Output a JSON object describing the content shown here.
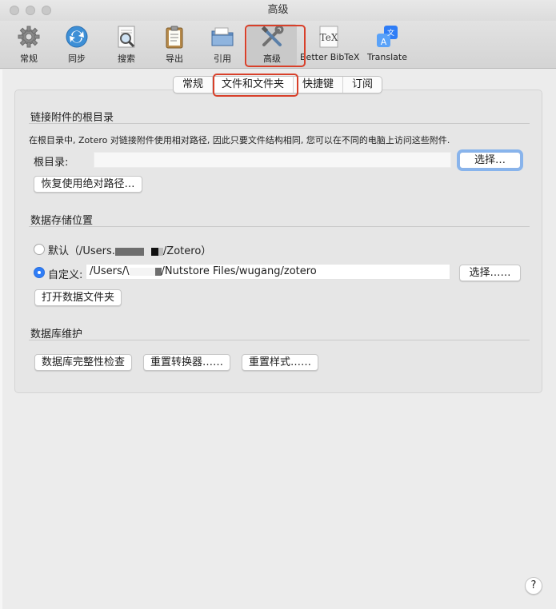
{
  "window": {
    "title": "高级"
  },
  "toolbar": {
    "items": [
      {
        "label": "常规",
        "icon": "gear-icon"
      },
      {
        "label": "同步",
        "icon": "sync-icon"
      },
      {
        "label": "搜索",
        "icon": "search-icon"
      },
      {
        "label": "导出",
        "icon": "clipboard-icon"
      },
      {
        "label": "引用",
        "icon": "folder-icon"
      },
      {
        "label": "高级",
        "icon": "tools-icon",
        "selected": true
      },
      {
        "label": "Better BibTeX",
        "icon": "tex-icon"
      },
      {
        "label": "Translate",
        "icon": "translate-icon"
      }
    ]
  },
  "tabs": {
    "items": [
      "常规",
      "文件和文件夹",
      "快捷键",
      "订阅"
    ],
    "active": "文件和文件夹"
  },
  "linked_attachments": {
    "title": "链接附件的根目录",
    "description": "在根目录中, Zotero 对链接附件使用相对路径, 因此只要文件结构相同, 您可以在不同的电脑上访问这些附件.",
    "base_dir_label": "根目录:",
    "base_dir_value": "",
    "choose_button": "选择…",
    "restore_button": "恢复使用绝对路径…"
  },
  "data_dir": {
    "title": "数据存储位置",
    "default_prefix": "默认（/Users.",
    "default_suffix": "/Zotero）",
    "custom_label": "自定义:",
    "custom_prefix": "/Users/\\",
    "custom_suffix": "/Nutstore Files/wugang/zotero",
    "choose_button": "选择……",
    "open_button": "打开数据文件夹"
  },
  "db_maintenance": {
    "title": "数据库维护",
    "check_button": "数据库完整性检查",
    "reset_translators_button": "重置转换器……",
    "reset_styles_button": "重置样式……"
  },
  "help": {
    "label": "?"
  },
  "colors": {
    "accent": "#2f7df6",
    "annotation_red": "#d8402a",
    "focus_ring": "#88b4ec"
  }
}
